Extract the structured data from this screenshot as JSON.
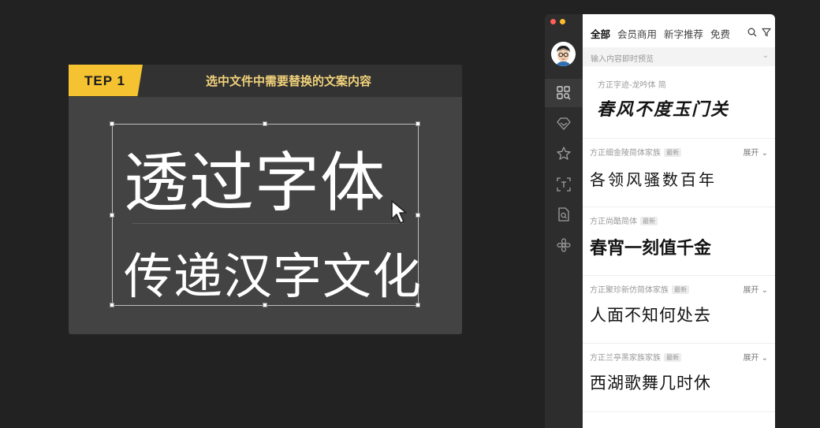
{
  "tutorial": {
    "step_label": "TEP 1",
    "caption": "选中文件中需要替换的文案内容",
    "line1": "透过字体",
    "line2": "传递汉字文化"
  },
  "app": {
    "traffic_colors": [
      "#ff5f57",
      "#febc2e"
    ],
    "sidebar_icons": [
      "grid-search-icon",
      "diamond-icon",
      "star-icon",
      "scan-text-icon",
      "file-search-icon",
      "flower-icon"
    ],
    "tabs": [
      "全部",
      "会员商用",
      "新字推荐",
      "免费"
    ],
    "search_placeholder": "输入内容即时预览",
    "expand_label": "展开",
    "new_badge": "最新",
    "fonts": [
      {
        "name": "方正字迹-龙吟体 简",
        "sample": "春风不度玉门关",
        "new": false,
        "expand": false
      },
      {
        "name": "方正细金陵简体家族",
        "sample": "各领风骚数百年",
        "new": true,
        "expand": true
      },
      {
        "name": "方正尚酷简体",
        "sample": "春宵一刻值千金",
        "new": true,
        "expand": false
      },
      {
        "name": "方正聚珍新仿简体家族",
        "sample": "人面不知何处去",
        "new": true,
        "expand": true
      },
      {
        "name": "方正兰亭黑家族家族",
        "sample": "西湖歌舞几时休",
        "new": true,
        "expand": true
      }
    ]
  }
}
